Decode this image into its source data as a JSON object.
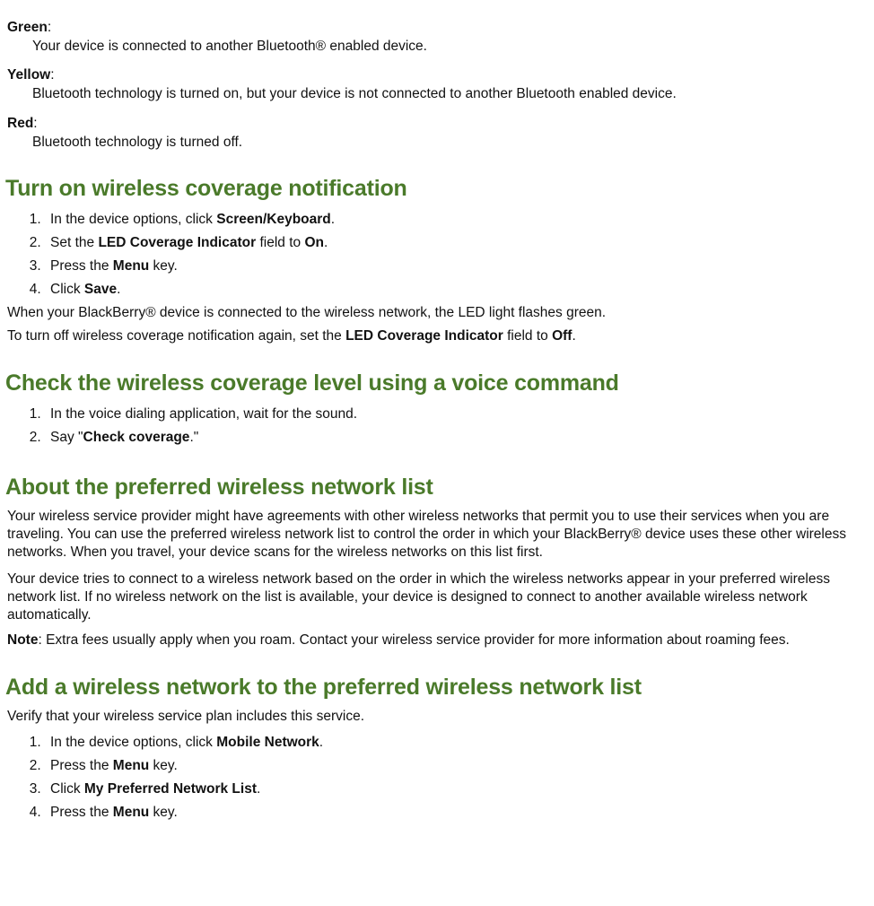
{
  "indicators": {
    "green": {
      "label": "Green",
      "text": "Your device is connected to another Bluetooth® enabled device."
    },
    "yellow": {
      "label": "Yellow",
      "text": "Bluetooth technology is turned on, but your device is not connected to another Bluetooth enabled device."
    },
    "red": {
      "label": "Red",
      "text": "Bluetooth technology is turned off."
    }
  },
  "sec1": {
    "heading": "Turn on wireless coverage notification",
    "step1_a": "In the device options, click ",
    "step1_b": "Screen/Keyboard",
    "step1_c": ".",
    "step2_a": "Set the ",
    "step2_b": "LED Coverage Indicator",
    "step2_c": " field to ",
    "step2_d": "On",
    "step2_e": ".",
    "step3_a": "Press the ",
    "step3_b": "Menu",
    "step3_c": " key.",
    "step4_a": "Click ",
    "step4_b": "Save",
    "step4_c": ".",
    "after1": "When your BlackBerry® device is connected to the wireless network, the LED light flashes green.",
    "after2_a": "To turn off wireless coverage notification again, set the ",
    "after2_b": "LED Coverage Indicator",
    "after2_c": " field to ",
    "after2_d": "Off",
    "after2_e": "."
  },
  "sec2": {
    "heading": "Check the wireless coverage level using a voice command",
    "step1": "In the voice dialing application, wait for the sound.",
    "step2_a": "Say \"",
    "step2_b": "Check coverage",
    "step2_c": ".\""
  },
  "sec3": {
    "heading": "About the preferred wireless network list",
    "p1": "Your wireless service provider might have agreements with other wireless networks that permit you to use their services when you are traveling. You can use the preferred wireless network list to control the order in which your BlackBerry® device uses these other wireless networks. When you travel, your device scans for the wireless networks on this list first.",
    "p2": "Your device tries to connect to a wireless network based on the order in which the wireless networks appear in your preferred wireless network list. If no wireless network on the list is available, your device is designed to connect to another available wireless network automatically.",
    "note_label": "Note",
    "note_text": ":  Extra fees usually apply when you roam. Contact your wireless service provider for more information about roaming fees."
  },
  "sec4": {
    "heading": "Add a wireless network to the preferred wireless network list",
    "intro": "Verify that your wireless service plan includes this service.",
    "step1_a": "In the device options, click ",
    "step1_b": "Mobile Network",
    "step1_c": ".",
    "step2_a": "Press the ",
    "step2_b": "Menu",
    "step2_c": " key.",
    "step3_a": "Click ",
    "step3_b": "My Preferred Network List",
    "step3_c": ".",
    "step4_a": "Press the ",
    "step4_b": "Menu",
    "step4_c": " key."
  }
}
